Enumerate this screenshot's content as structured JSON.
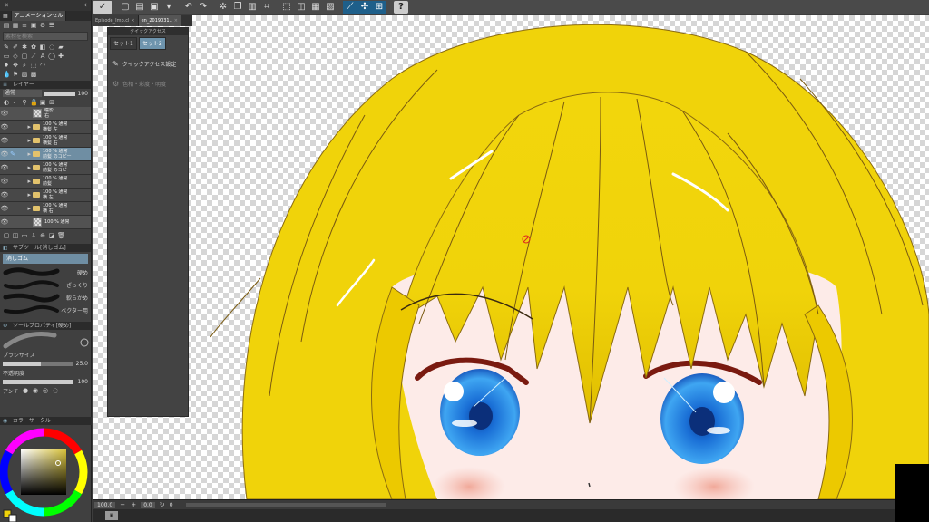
{
  "command_bar": {
    "logo": "✓",
    "help": "?"
  },
  "doc_tabs": [
    {
      "label": "Episode_Imp.cl",
      "active": false
    },
    {
      "label": "en_2019031..",
      "active": true
    }
  ],
  "sidebar": {
    "anim_tabs": [
      "",
      "アニメーションセル"
    ],
    "search_placeholder": "素材を検索",
    "layer_panel_title": "レイヤー",
    "blend_mode": "通常",
    "opacity": 100,
    "layers": [
      {
        "line1": "瞳影",
        "line2": "右",
        "type": "tone",
        "visible": true
      },
      {
        "line1": "100 % 通常",
        "line2": "横髪 左",
        "type": "folder",
        "visible": true
      },
      {
        "line1": "100 % 通常",
        "line2": "横髪 右",
        "type": "folder",
        "visible": true
      },
      {
        "line1": "100 % 通常",
        "line2": "前髪 のコピー",
        "type": "folder",
        "visible": true,
        "selected": true
      },
      {
        "line1": "100 % 通常",
        "line2": "前髪 のコピー",
        "type": "folder",
        "visible": true
      },
      {
        "line1": "100 % 通常",
        "line2": "前髪",
        "type": "folder",
        "visible": true
      },
      {
        "line1": "100 % 通常",
        "line2": "横 左",
        "type": "folder",
        "visible": true
      },
      {
        "line1": "100 % 通常",
        "line2": "横 右",
        "type": "folder",
        "visible": true
      },
      {
        "line1": "100 % 通常",
        "line2": "",
        "type": "tone",
        "visible": true
      }
    ],
    "subtool_title": "サブツール[消しゴム]",
    "subtool_selected": "消しゴム",
    "brushes": [
      {
        "label": "硬め"
      },
      {
        "label": "ざっくり"
      },
      {
        "label": "軟らかめ"
      },
      {
        "label": "ベクター用"
      }
    ],
    "tool_prop_title": "ツールプロパティ[硬め]",
    "brush_size_label": "ブラシサイズ",
    "brush_size": "25.0",
    "brush_size_fraction": 0.55,
    "opacity_label": "不透明度",
    "opacity_value": "100",
    "opacity_fraction": 1.0,
    "antialias_label": "アンチ",
    "color_title": "カラーサークル"
  },
  "quick_access": {
    "title": "クイックアクセス",
    "tabs": [
      {
        "label": "セット1",
        "active": false
      },
      {
        "label": "セット2",
        "active": true
      }
    ],
    "items": [
      {
        "icon": "✎",
        "label": "クイックアクセス設定",
        "dim": false
      },
      {
        "icon": "⚙",
        "label": "色相・彩度・明度",
        "dim": true
      }
    ]
  },
  "status": {
    "zoom": "100.0",
    "angle": "0.0",
    "extra": "0"
  },
  "taskbar": {
    "label": "▣"
  },
  "colors": {
    "hair": "#f0d30a",
    "hair_shade": "#e5c200",
    "hair_line": "#8a6a10",
    "skin": "#fdebe8",
    "iris": "#2a84e0",
    "blush": "#f3b4a8",
    "selection_blue": "#6f8ea3"
  }
}
